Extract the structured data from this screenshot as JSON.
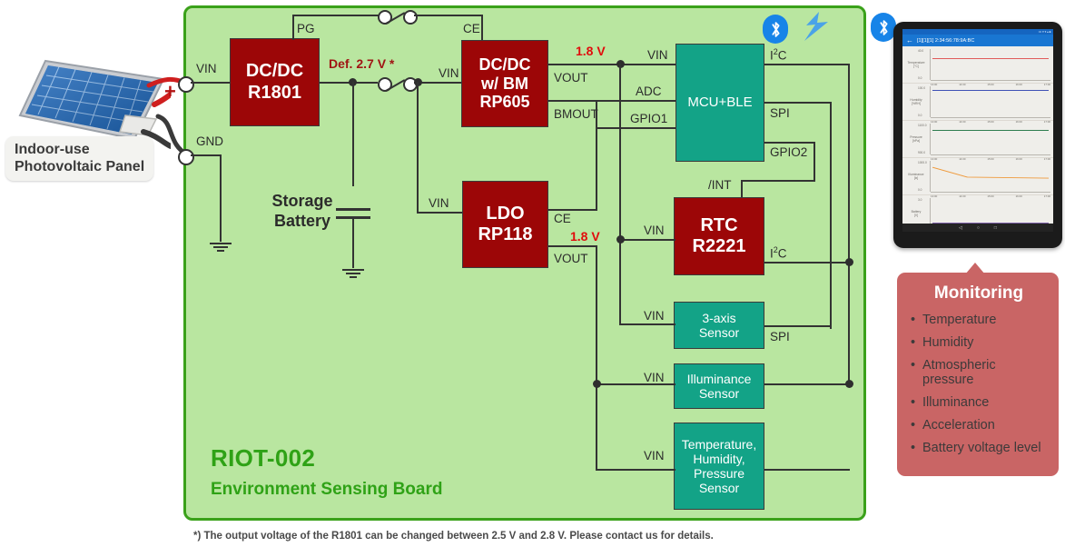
{
  "board": {
    "title": "RIOT-002",
    "subtitle": "Environment Sensing Board",
    "accent_color": "#2fa216",
    "fill_color": "#b9e6a0"
  },
  "source": {
    "caption_line1": "Indoor-use",
    "caption_line2": "Photovoltaic Panel",
    "plus_label": "+",
    "vin_label": "VIN",
    "gnd_label": "GND"
  },
  "storage": {
    "label_line1": "Storage",
    "label_line2": "Battery"
  },
  "blocks": {
    "dcdc_r1801": {
      "line1": "DC/DC",
      "line2": "R1801",
      "pin_pg": "PG",
      "pin_vin": "VIN",
      "color": "#9c0607"
    },
    "dcdc_rp605": {
      "line1": "DC/DC",
      "line2": "w/ BM",
      "line3": "RP605",
      "pin_ce": "CE",
      "pin_vin": "VIN",
      "pin_vout": "VOUT",
      "pin_bmout": "BMOUT",
      "out_voltage": "1.8 V",
      "color": "#9c0607"
    },
    "ldo_rp118": {
      "line1": "LDO",
      "line2": "RP118",
      "pin_vin": "VIN",
      "pin_ce": "CE",
      "pin_vout": "VOUT",
      "out_voltage": "1.8 V",
      "color": "#9c0607"
    },
    "mcu_ble": {
      "label": "MCU+BLE",
      "pin_vin": "VIN",
      "pin_adc": "ADC",
      "pin_gpio1": "GPIO1",
      "pin_i2c": "I²C",
      "pin_spi": "SPI",
      "pin_gpio2": "GPIO2",
      "color": "#13a387"
    },
    "rtc_r2221": {
      "line1": "RTC",
      "line2": "R2221",
      "pin_int": "/INT",
      "pin_vin": "VIN",
      "pin_i2c": "I²C",
      "color": "#9c0607"
    },
    "accel_sensor": {
      "line1": "3-axis",
      "line2": "Sensor",
      "pin_vin": "VIN",
      "pin_spi": "SPI",
      "color": "#13a387"
    },
    "illuminance_sensor": {
      "line1": "Illuminance",
      "line2": "Sensor",
      "pin_vin": "VIN",
      "color": "#13a387"
    },
    "thp_sensor": {
      "line1": "Temperature,",
      "line2": "Humidity,",
      "line3": "Pressure",
      "line4": "Sensor",
      "pin_vin": "VIN",
      "color": "#13a387"
    }
  },
  "annotations": {
    "default_voltage": "Def. 2.7 V *",
    "default_voltage_color": "#a01414",
    "rail_voltage": "1.8 V",
    "rail_voltage_color": "#e10c0c"
  },
  "footnote": "*) The output voltage of the R1801 can be changed between 2.5 V and 2.8 V. Please contact us for details.",
  "monitoring": {
    "title": "Monitoring",
    "items": [
      "Temperature",
      "Humidity",
      "Atmospheric pressure",
      "Illuminance",
      "Acceleration",
      "Battery voltage level"
    ],
    "panel_color": "#c96565"
  },
  "tablet": {
    "status_text": "•••   ▾ ▾ ▴  ■",
    "app_title": "[1][1][1] 2:34:56:78:9A:BC",
    "back_icon": "←",
    "nav_icons": [
      "◁",
      "○",
      "□"
    ],
    "charts": [
      {
        "name": "Temperature",
        "unit": "[°C]",
        "color": "#e05b5b",
        "y_top": "40.0",
        "y_bottom": "0.0",
        "x_ticks": [
          "13:00",
          "14:00",
          "15:00",
          "16:00",
          "17:00"
        ]
      },
      {
        "name": "Humidity",
        "unit": "[%RH]",
        "color": "#3f51b5",
        "y_top": "100.0",
        "y_bottom": "0.0",
        "x_ticks": [
          "13:00",
          "14:00",
          "15:00",
          "16:00",
          "17:00"
        ]
      },
      {
        "name": "Pressure",
        "unit": "[hPa]",
        "color": "#2e7d4f",
        "y_top": "1100.0",
        "y_bottom": "900.0",
        "x_ticks": [
          "13:00",
          "14:00",
          "15:00",
          "16:00",
          "17:00"
        ]
      },
      {
        "name": "Illuminance",
        "unit": "[lx]",
        "color": "#ef9a3c",
        "y_top": "1000.0",
        "y_bottom": "0.0",
        "x_ticks": [
          "13:00",
          "14:00",
          "15:00",
          "16:00",
          "17:00"
        ]
      },
      {
        "name": "Battery",
        "unit": "[V]",
        "color": "#7b5ea7",
        "y_top": "3.0",
        "y_bottom": "0.0",
        "x_ticks": [
          "13:00",
          "14:00",
          "15:00",
          "16:00",
          "17:00"
        ]
      }
    ]
  },
  "icons": {
    "bluetooth": "ᛦ",
    "wireless_bolt": "signal-bolt"
  }
}
